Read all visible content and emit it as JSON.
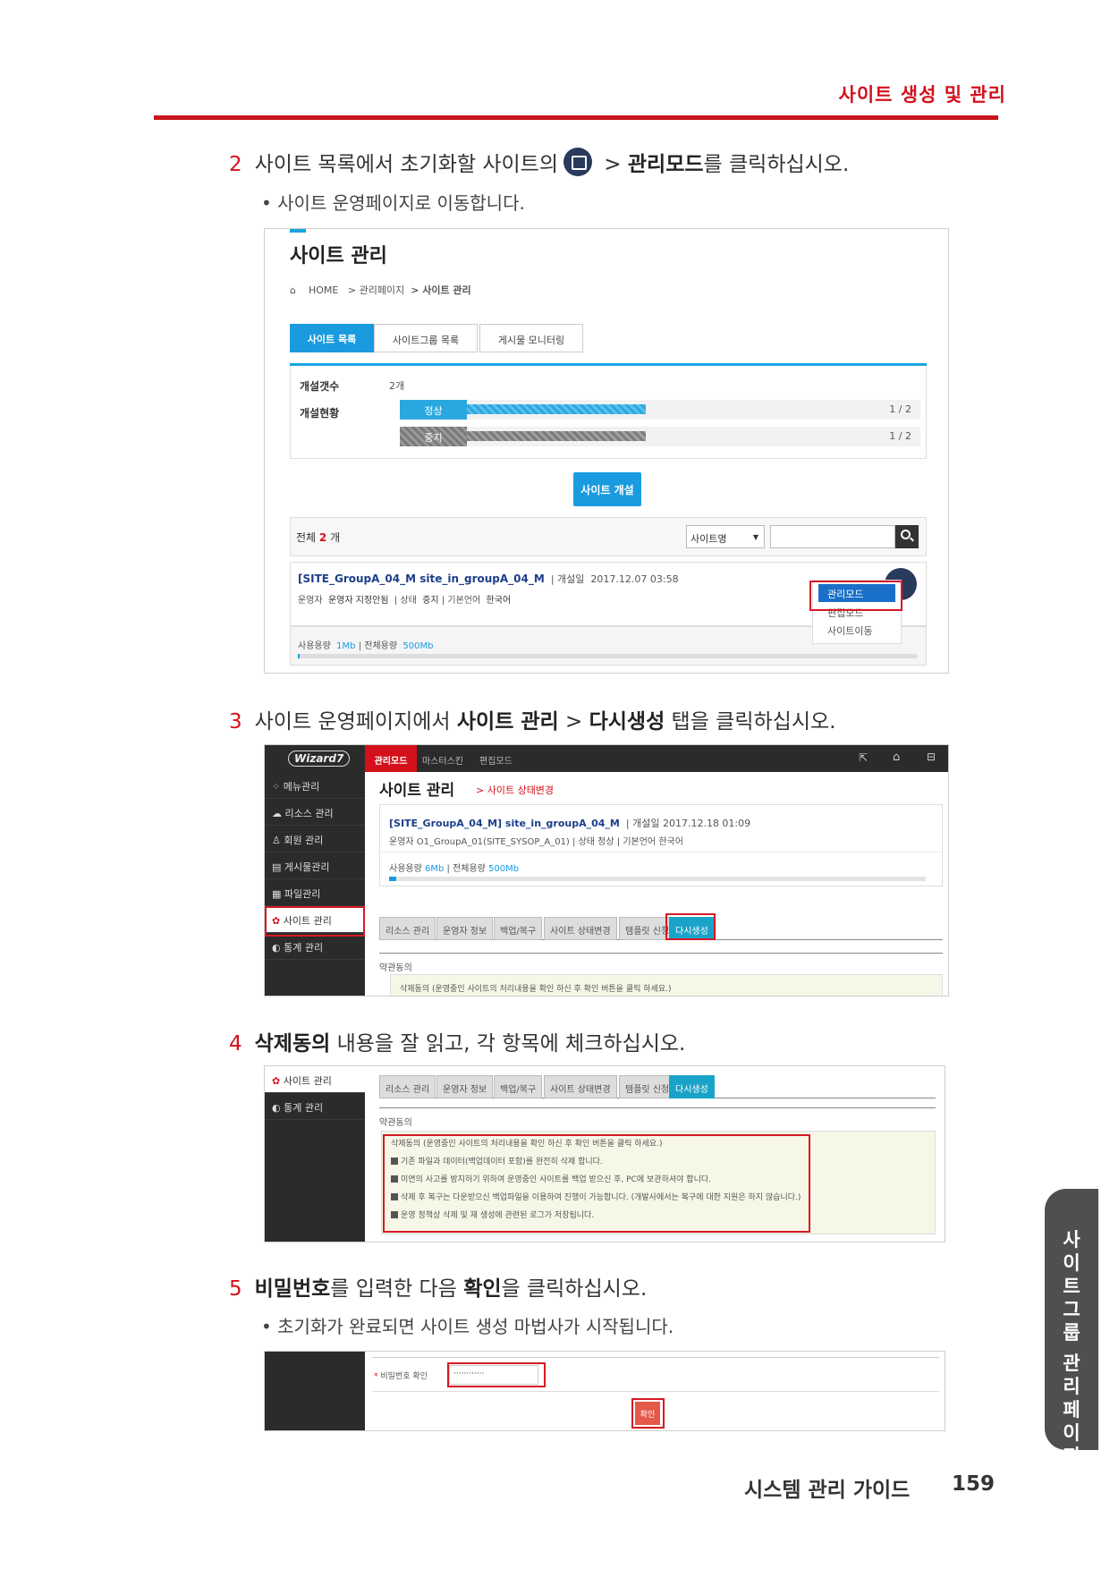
{
  "header": {
    "title": "사이트 생성 및 관리"
  },
  "step2": {
    "num": "2",
    "text_a": "사이트 목록에서 초기화할 사이트의",
    "text_b": " > ",
    "bold": "관리모드",
    "text_c": "를 클릭하십시오.",
    "bullet": "사이트 운영페이지로 이동합니다."
  },
  "shot1": {
    "title": "사이트 관리",
    "breadcrumb": {
      "home": "HOME",
      "b1": "> 관리페이지",
      "b2": "> 사이트 관리"
    },
    "tabs": [
      "사이트 목록",
      "사이트그룹 목록",
      "게시물 모니터링"
    ],
    "stats": {
      "count_label": "개설갯수",
      "count_value": "2개",
      "status_label": "개설현황",
      "normal": "정상",
      "normal_ratio": "1 / 2",
      "normal_fill": 0.5,
      "stopped": "중지",
      "stopped_ratio": "1 / 2",
      "stopped_fill": 0.5
    },
    "open_button": "사이트 개설",
    "total": {
      "a": "전체 ",
      "n": "2",
      "b": " 개"
    },
    "search": {
      "select": "사이트명",
      "arrow": "▼"
    },
    "site": {
      "name": "[SITE_GroupA_04_M site_in_groupA_04_M",
      "date_label": "개설일",
      "date": "2017.12.07 03:58",
      "op_label": "운영자",
      "op_value": "운영자 지정안됨",
      "status_label": "상태",
      "status_value": "중지",
      "lang_label": "기본언어",
      "lang_value": "한국어",
      "used_label": "사용용량",
      "used": "1Mb",
      "total_label": "전체용량",
      "total": "500Mb"
    },
    "menu": [
      "관리모드",
      "편집모드",
      "사이트이동"
    ]
  },
  "step3": {
    "num": "3",
    "text_a": "사이트 운영페이지에서 ",
    "bold1": "사이트 관리",
    "text_b": " > ",
    "bold2": "다시생성",
    "text_c": " 탭을 클릭하십시오."
  },
  "shot2": {
    "logo": "Wizard7",
    "top_tabs": [
      "관리모드",
      "마스터스킨",
      "편집모드"
    ],
    "side": [
      "메뉴관리",
      "리소스 관리",
      "회원 관리",
      "게시물관리",
      "파일관리",
      "사이트 관리",
      "통계 관리"
    ],
    "title": "사이트 관리",
    "sub": "> 사이트 상태변경",
    "site": {
      "name": "[SITE_GroupA_04_M] site_in_groupA_04_M",
      "date_label": "개설일",
      "date": "2017.12.18 01:09",
      "op_label": "운영자",
      "op_value": "O1_GroupA_01(SITE_SYSOP_A_01)",
      "status_label": "상태",
      "status_value": "정상",
      "lang_label": "기본언어",
      "lang_value": "한국어",
      "used_label": "사용용량",
      "used": "6Mb",
      "total_label": "전체용량",
      "total": "500Mb"
    },
    "tabs": [
      "리소스 관리",
      "운영자 정보",
      "백업/복구",
      "사이트 상태변경",
      "템플릿 신청",
      "다시생성"
    ],
    "agree_label": "약관동의",
    "agree_text": "삭제동의 (운영중인 사이트의 처리내용을 확인 하신 후 확인 버튼을 클릭 하세요.)"
  },
  "step4": {
    "num": "4",
    "bold": "삭제동의",
    "text": " 내용을 잘 읽고, 각 항목에 체크하십시오."
  },
  "shot3": {
    "side": [
      "사이트 관리",
      "통계 관리"
    ],
    "tabs": [
      "리소스 관리",
      "운영자 정보",
      "백업/복구",
      "사이트 상태변경",
      "템플릿 신청",
      "다시생성"
    ],
    "agree_label": "약관동의",
    "items": [
      "삭제동의 (운영중인 사이트의 처리내용을 확인 하신 후 확인 버튼을 클릭 하세요.)",
      "기존 파일과 데이터(백업데이터 포함)를 완전히 삭제 합니다.",
      "미연의 사고를 방지하기 위하여 운영중인 사이트를 백업 받으신 후, PC에 보관하셔야 합니다.",
      "삭제 후 복구는 다운받으신 백업파일을 이용하여 진행이 가능합니다. (개발사에서는 복구에 대한 지원은 하지 않습니다.)",
      "운영 정책상 삭제 및 재 생성에 관련된 로그가 저장됩니다."
    ]
  },
  "step5": {
    "num": "5",
    "bold1": "비밀번호",
    "text_a": "를 입력한 다음 ",
    "bold2": "확인",
    "text_b": "을 클릭하십시오.",
    "bullet": "초기화가 완료되면 사이트 생성 마법사가 시작됩니다."
  },
  "shot4": {
    "star": "*",
    "label": "비밀번호 확인",
    "value": "············",
    "button": "확인"
  },
  "sidetab": [
    "사",
    "이",
    "트",
    "그",
    "룹",
    "관",
    "리",
    "페",
    "이",
    "지"
  ],
  "footer": {
    "title": "시스템 관리 가이드",
    "page": "159"
  }
}
